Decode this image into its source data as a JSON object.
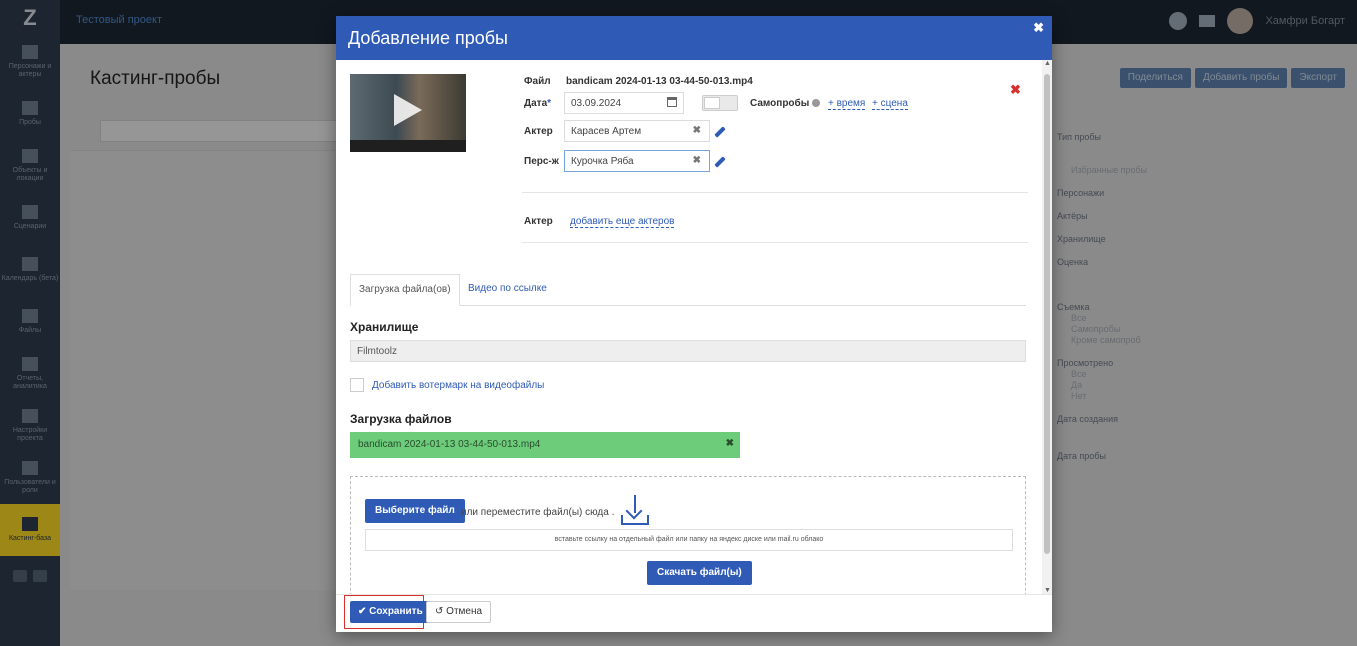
{
  "app": {
    "breadcrumb": "Тестовый проект",
    "user_name": "Хамфри Богарт",
    "page_title": "Кастинг-пробы"
  },
  "sidebar": {
    "items": [
      {
        "label": "Персонажи и актеры",
        "icon": "people-icon"
      },
      {
        "label": "Пробы",
        "icon": "camera-icon"
      },
      {
        "label": "Объекты и локации",
        "icon": "location-icon"
      },
      {
        "label": "Сценарии",
        "icon": "script-icon"
      },
      {
        "label": "Календарь (бета)",
        "icon": "calendar-icon"
      },
      {
        "label": "Файлы",
        "icon": "file-icon"
      },
      {
        "label": "Отчеты, аналитика",
        "icon": "chart-icon"
      },
      {
        "label": "Настройки проекта",
        "icon": "settings-icon"
      },
      {
        "label": "Пользователи и роли",
        "icon": "users-icon"
      },
      {
        "label": "Кастинг-база",
        "icon": "star-icon"
      }
    ]
  },
  "right_panel": {
    "buttons": [
      "Поделиться",
      "Добавить пробы",
      "Экспорт"
    ],
    "filters": {
      "type_label": "Тип пробы",
      "favorites": "Избранные пробы",
      "characters": "Персонажи",
      "actors": "Актёры",
      "storage": "Хранилище",
      "rating": "Оценка",
      "shooting": "Съемка",
      "shooting_options": [
        "Все",
        "Самопробы",
        "Кроме самопроб"
      ],
      "viewed": "Просмотрено",
      "viewed_options": [
        "Все",
        "Да",
        "Нет"
      ],
      "created": "Дата создания",
      "probe_date": "Дата пробы"
    }
  },
  "modal": {
    "title": "Добавление пробы",
    "file_label": "Файл",
    "file_name": "bandicam 2024-01-13 03-44-50-013.mp4",
    "date_label": "Дата",
    "date_required": "*",
    "date_value": "03.09.2024",
    "self_label": "Самопробы",
    "add_time": "+ время",
    "add_scene": "+ сцена",
    "actor_label": "Актер",
    "actor_value": "Карасев Артем",
    "char_label": "Перс-ж",
    "char_value": "Курочка Ряба",
    "actor2_label": "Актер",
    "add_more_actors": "добавить еще актеров",
    "tabs": [
      "Загрузка файла(ов)",
      "Видео по ссылке"
    ],
    "storage_title": "Хранилище",
    "storage_value": "Filmtoolz",
    "watermark_label": "Добавить вотермарк на видеофайлы",
    "upload_title": "Загрузка файлов",
    "uploaded_file": "bandicam 2024-01-13 03-44-50-013.mp4",
    "choose_file": "Выберите файл",
    "drop_text": "или переместите файл(ы) сюда .",
    "url_placeholder": "вставьте ссылку на отдельный файл или папку на яндекс диске или mail.ru облако",
    "download_btn": "Скачать файл(ы)",
    "save_btn": "Сохранить",
    "cancel_btn": "Отмена"
  },
  "colors": {
    "primary": "#2f5bb7",
    "sidebar": "#2b3a4a",
    "active_nav": "#f2d024",
    "success_bar": "#6ccc7a",
    "danger": "#d9302c"
  }
}
